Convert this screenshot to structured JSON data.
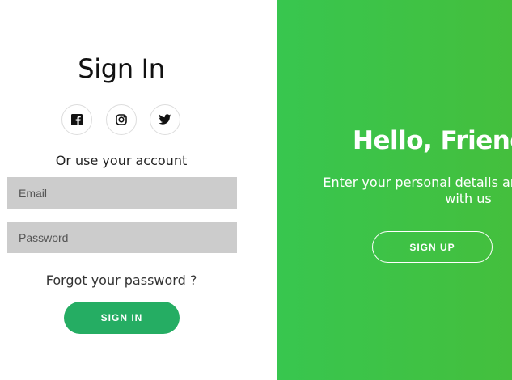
{
  "signin": {
    "title": "Sign In",
    "social": [
      {
        "icon": "facebook-icon"
      },
      {
        "icon": "instagram-icon"
      },
      {
        "icon": "twitter-icon"
      }
    ],
    "alt_text": "Or use your account",
    "email_placeholder": "Email",
    "password_placeholder": "Password",
    "forgot_label": "Forgot your password ?",
    "button_label": "SIGN IN"
  },
  "overlay": {
    "title": "Hello, Friend!",
    "text": "Enter your personal details and start journey with us",
    "button_label": "SIGN UP"
  },
  "colors": {
    "accent": "#25ad63",
    "overlay_start": "#38c64f",
    "overlay_end": "#44bf3d",
    "input_bg": "#cccccc"
  }
}
